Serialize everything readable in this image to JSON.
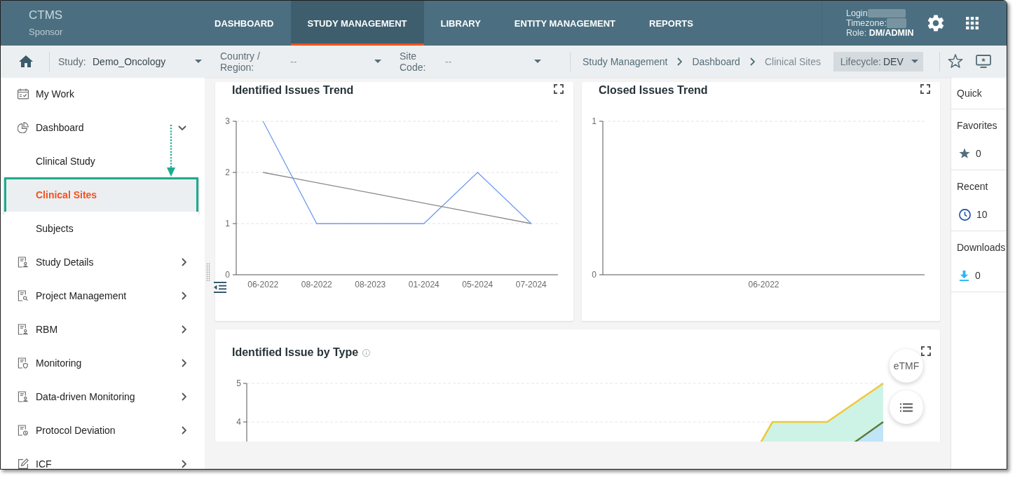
{
  "header": {
    "brand": {
      "title": "CTMS",
      "subtitle": "Sponsor"
    },
    "nav": [
      {
        "label": "DASHBOARD",
        "selected": false
      },
      {
        "label": "STUDY MANAGEMENT",
        "selected": true
      },
      {
        "label": "LIBRARY",
        "selected": false
      },
      {
        "label": "ENTITY MANAGEMENT",
        "selected": false
      },
      {
        "label": "REPORTS",
        "selected": false
      }
    ],
    "user": {
      "login": "Login",
      "timezone": "Timezone:",
      "role": "Role: **DM/ADMIN**"
    }
  },
  "filter_bar": {
    "filters": [
      {
        "label": "Study:",
        "value": "Demo_Oncology"
      },
      {
        "label": "Country / Region:",
        "placeholder": "--"
      },
      {
        "label": "Site Code:",
        "placeholder": "--"
      }
    ],
    "breadcrumbs": [
      {
        "label": "Study Management",
        "current": false
      },
      {
        "label": "Dashboard",
        "current": false
      },
      {
        "label": "Clinical Sites",
        "current": true
      }
    ],
    "lifecycle": {
      "label": "Lifecycle:",
      "value": "DEV"
    }
  },
  "sidebar": {
    "items": [
      {
        "kind": "link",
        "label": "My Work",
        "selected": false
      },
      {
        "kind": "group",
        "label": "Dashboard",
        "selected": false,
        "expanded": true,
        "children": [
          {
            "label": "Clinical Study",
            "selected": false,
            "callout": false
          },
          {
            "label": "Clinical Sites",
            "selected": true,
            "callout": true
          },
          {
            "label": "Subjects",
            "selected": false,
            "callout": false
          }
        ]
      },
      {
        "kind": "group",
        "label": "Study Details",
        "selected": false,
        "expanded": false
      },
      {
        "kind": "group",
        "label": "Project Management",
        "selected": false,
        "expanded": false
      },
      {
        "kind": "group",
        "label": "RBM",
        "selected": false,
        "expanded": false
      },
      {
        "kind": "group",
        "label": "Monitoring",
        "selected": false,
        "expanded": false
      },
      {
        "kind": "group",
        "label": "Data-driven Monitoring",
        "selected": false,
        "expanded": false
      },
      {
        "kind": "group",
        "label": "Protocol Deviation",
        "selected": false,
        "expanded": false
      },
      {
        "kind": "group",
        "label": "ICF",
        "selected": false,
        "expanded": false
      }
    ]
  },
  "charts": [
    {
      "kind": "line",
      "title": "Identified Issues Trend",
      "info": false,
      "chart_data": {
        "type": "line",
        "categories": [
          "06-2022",
          "08-2022",
          "08-2023",
          "01-2024",
          "05-2024",
          "07-2024"
        ],
        "ylim": [
          0,
          3
        ],
        "yticks": [
          0,
          1,
          2,
          3
        ],
        "series": [
          {
            "color": "#6f9cf3",
            "values": [
              3,
              1,
              1,
              1,
              2,
              1
            ]
          },
          {
            "color": "#8a8a8a",
            "values": [
              2,
              1.8,
              1.6,
              1.4,
              1.2,
              1
            ]
          }
        ]
      }
    },
    {
      "kind": "line",
      "title": "Closed Issues Trend",
      "info": false,
      "chart_data": {
        "type": "line",
        "categories": [
          "06-2022"
        ],
        "ylim": [
          0,
          1
        ],
        "yticks": [
          0,
          1
        ]
      }
    },
    {
      "kind": "area",
      "title": "Identified Issue by Type",
      "info": true,
      "y_labels": [
        "5",
        "4"
      ]
    }
  ],
  "floating_actions": [
    {
      "kind": "text",
      "label": "eTMF"
    },
    {
      "kind": "list"
    }
  ],
  "quick_panel": {
    "title": "Quick",
    "sections": [
      {
        "kind": "favorites",
        "title": "Favorites",
        "count": "0"
      },
      {
        "kind": "recent",
        "title": "Recent",
        "count": "10"
      },
      {
        "kind": "downloads",
        "title": "Downloads",
        "count": "0"
      }
    ]
  }
}
